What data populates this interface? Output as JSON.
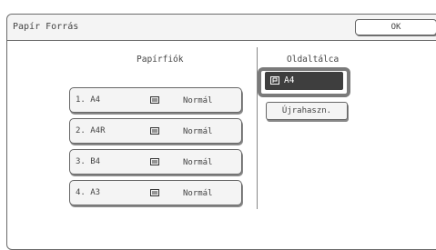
{
  "window": {
    "title": "Papír Forrás",
    "ok_label": "OK"
  },
  "left_section": {
    "heading": "Papírfiók",
    "trays": [
      {
        "name": "1. A4",
        "type": "Normál",
        "icon": "paper-tray-icon"
      },
      {
        "name": "2. A4R",
        "type": "Normál",
        "icon": "paper-tray-icon"
      },
      {
        "name": "3. B4",
        "type": "Normál",
        "icon": "paper-tray-icon"
      },
      {
        "name": "4. A3",
        "type": "Normál",
        "icon": "paper-tray-icon"
      }
    ]
  },
  "right_section": {
    "heading": "Oldaltálca",
    "selected": {
      "label": "A4",
      "icon": "bypass-tray-icon",
      "selected": true
    },
    "reuse_label": "Újrahaszn."
  },
  "colors": {
    "selected_bg": "#3e3e3e",
    "highlight_border": "#7a7a7a",
    "border": "#666666"
  }
}
